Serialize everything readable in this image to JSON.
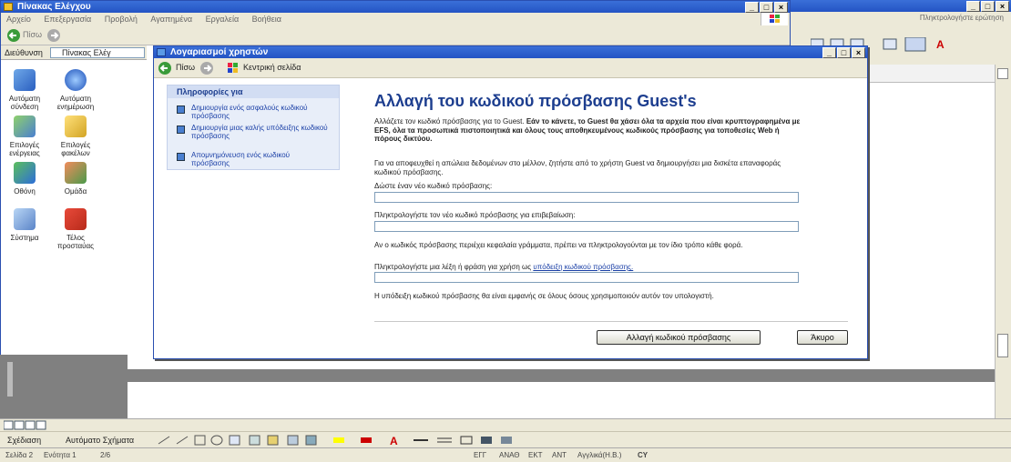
{
  "background_window": {
    "title": "Πίνακας Ελέγχου",
    "menu": [
      "Αρχείο",
      "Επεξεργασία",
      "Προβολή",
      "Αγαπημένα",
      "Εργαλεία",
      "Βοήθεια"
    ],
    "back_label": "Πίσω",
    "address_label": "Διεύθυνση",
    "address_value": "Πίνακας Ελέγ",
    "items": [
      {
        "label": "Αυτόματη\nσύνδεση",
        "icon": "network-icon"
      },
      {
        "label": "Αυτόματη\nενημέρωση",
        "icon": "update-icon"
      },
      {
        "label": "Επιλογές\nενέργειας",
        "icon": "power-options-icon"
      },
      {
        "label": "Επιλογές\nφακέλων",
        "icon": "folder-options-icon"
      },
      {
        "label": "Οθόνη",
        "icon": "display-icon"
      },
      {
        "label": "Ομάδα",
        "icon": "group-icon"
      },
      {
        "label": "Σύστημα",
        "icon": "system-icon"
      },
      {
        "label": "Τέλος\nπροσταύας",
        "icon": "tasks-icon"
      }
    ]
  },
  "word_window": {
    "task_pane_title": "Πληκτρολογήστε ερώτηση",
    "draw_menu": "Σχέδιαση",
    "autoshapes": "Αυτόματο Σχήματα",
    "status": [
      "Σελίδα 2",
      "Ενότητα 1",
      "2/6",
      "",
      "",
      "",
      "ΕΓΓ",
      "ΑΝΑΘ",
      "ΕΚΤ",
      "ΑΝΤ",
      "Αγγλικά(Η.Β.)",
      "CY"
    ]
  },
  "dialog": {
    "title": "Λογαριασμοί χρηστών",
    "back_label": "Πίσω",
    "home_label": "Κεντρική σελίδα",
    "sidebar_heading": "Πληροφορίες για",
    "sidebar_links": [
      "Δημιουργία ενός ασφαλούς κωδικού πρόσβασης",
      "Δημιουργία μιας καλής υπόδειξης κωδικού πρόσβασης",
      "Απομνημόνευση ενός κωδικού πρόσβασης"
    ],
    "heading": "Αλλαγή του κωδικού πρόσβασης Guest's",
    "warning_normal": "Αλλάζετε τον κωδικό πρόσβασης για το Guest. ",
    "warning_bold": "Εάν το κάνετε, το Guest θα χάσει όλα τα αρχεία που είναι κρυπτογραφημένα με EFS, όλα τα προσωπικά πιστοποιητικά και όλους τους αποθηκευμένους κωδικούς πρόσβασης για τοποθεσίες Web ή πόρους δικτύου.",
    "advice": "Για να αποφευχθεί η απώλεια δεδομένων στο μέλλον, ζητήστε από το χρήστη Guest να δημιουργήσει μια δισκέτα επαναφοράς κωδικού πρόσβασης.",
    "new_password_label": "Δώστε έναν νέο κωδικό πρόσβασης:",
    "new_password_value": "",
    "confirm_label": "Πληκτρολογήστε τον νέο κωδικό πρόσβασης για επιβεβαίωση:",
    "confirm_value": "",
    "case_note": "Αν ο κωδικός πρόσβασης περιέχει κεφαλαία γράμματα, πρέπει να πληκτρολογούνται με τον ίδιο τρόπο κάθε φορά.",
    "hint_label_prefix": "Πληκτρολογήστε μια λέξη ή φράση για χρήση ως ",
    "hint_link": "υπόδειξη κωδικού πρόσβασης.",
    "hint_value": "",
    "hint_note": "Η υπόδειξη κωδικού πρόσβασης θα είναι εμφανής σε όλους όσους χρησιμοποιούν αυτόν τον υπολογιστή.",
    "change_button": "Αλλαγή κωδικού πρόσβασης",
    "cancel_button": "Άκυρο"
  },
  "colors": {
    "title_blue": "#2454c4",
    "link_blue": "#1a3fa6",
    "heading_blue": "#1d3e8f",
    "chrome": "#ece9d8"
  }
}
